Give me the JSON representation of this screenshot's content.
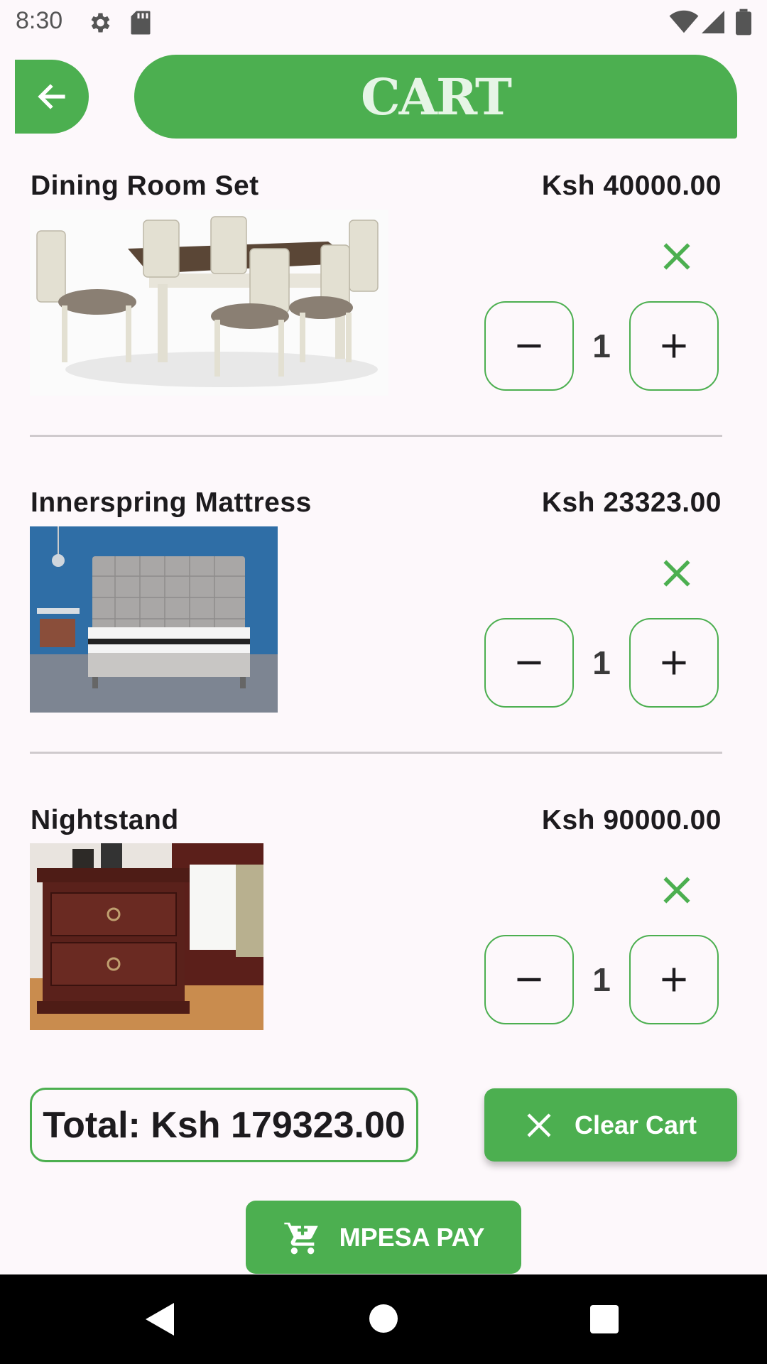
{
  "status_bar": {
    "time": "8:30"
  },
  "header": {
    "title": "CART",
    "back_icon": "arrow-left-icon"
  },
  "items": [
    {
      "name": "Dining Room Set",
      "price": "Ksh 40000.00",
      "quantity": "1"
    },
    {
      "name": "Innerspring Mattress",
      "price": "Ksh 23323.00",
      "quantity": "1"
    },
    {
      "name": "Nightstand",
      "price": "Ksh 90000.00",
      "quantity": "1"
    }
  ],
  "footer": {
    "total": "Total: Ksh 179323.00",
    "clear_label": "Clear Cart",
    "pay_label": "MPESA PAY"
  },
  "colors": {
    "accent": "#4caf50",
    "title_text": "#e6f5e6",
    "background": "#fdf8fb"
  }
}
